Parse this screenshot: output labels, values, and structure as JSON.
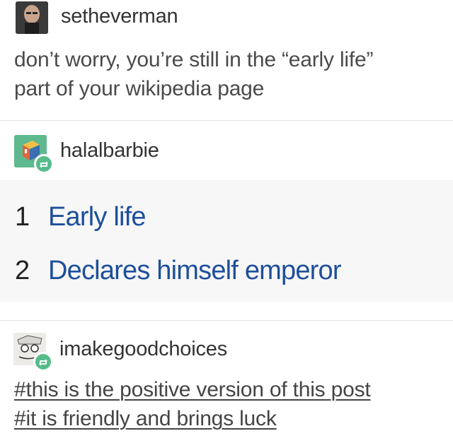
{
  "post1": {
    "username": "setheverman",
    "text_line1": "don’t worry, you’re still in the “early life”",
    "text_line2": "part of your wikipedia page"
  },
  "post2": {
    "username": "halalbarbie",
    "toc": [
      {
        "num": "1",
        "label": "Early life"
      },
      {
        "num": "2",
        "label": "Declares himself emperor"
      }
    ]
  },
  "post3": {
    "username": "imakegoodchoices",
    "tags": [
      "#this is the positive version of this post",
      "#it is friendly and brings luck"
    ]
  },
  "colors": {
    "reblog_badge": "#56bc8a",
    "link_blue": "#1d4f9a",
    "avatar2_bg": "#5fb98e"
  }
}
